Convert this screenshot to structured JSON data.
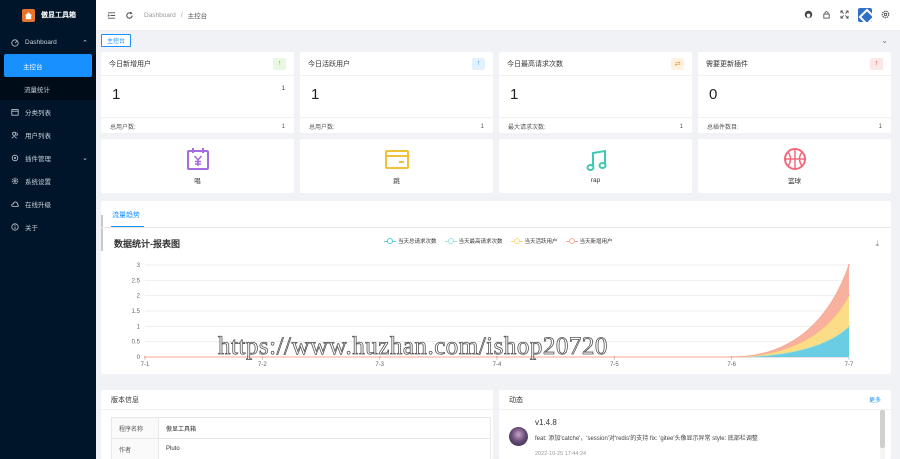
{
  "app": {
    "title": "傲显工具箱"
  },
  "sidebar": {
    "items": [
      {
        "label": "Dashboard",
        "icon": "dashboard-icon"
      },
      {
        "label": "主控台",
        "icon": ""
      },
      {
        "label": "流量统计",
        "icon": ""
      },
      {
        "label": "分类列表",
        "icon": "list-icon"
      },
      {
        "label": "用户列表",
        "icon": "users-icon"
      },
      {
        "label": "插件管理",
        "icon": "plugin-icon"
      },
      {
        "label": "系统设置",
        "icon": "gear-icon"
      },
      {
        "label": "在线升级",
        "icon": "cloud-icon"
      },
      {
        "label": "关于",
        "icon": "info-icon"
      }
    ]
  },
  "header": {
    "breadcrumb_root": "Dashboard",
    "breadcrumb_sep": "/",
    "breadcrumb_current": "主控台"
  },
  "tags": {
    "active": "主控台"
  },
  "stats": [
    {
      "title": "今日新增用户",
      "badge": "↑",
      "badge_color": "#52c41a",
      "badge_bg": "#e8f8e2",
      "value": "1",
      "small": "1",
      "foot_label": "总用户数:",
      "foot_value": "1"
    },
    {
      "title": "今日活跃用户",
      "badge": "↑",
      "badge_color": "#1890ff",
      "badge_bg": "#e3f1ff",
      "value": "1",
      "small": "",
      "foot_label": "总用户数:",
      "foot_value": "1"
    },
    {
      "title": "今日最高请求次数",
      "badge": "⇄",
      "badge_color": "#fa8c16",
      "badge_bg": "#fff1e0",
      "value": "1",
      "small": "",
      "foot_label": "最大请求次数:",
      "foot_value": "1"
    },
    {
      "title": "需要更新插件",
      "badge": "↑",
      "badge_color": "#f5222d",
      "badge_bg": "#fde8e8",
      "value": "0",
      "small": "",
      "foot_label": "总插件数目:",
      "foot_value": "1"
    }
  ],
  "tiles": [
    {
      "label": "唱",
      "icon": "calendar-yen-icon",
      "color": "#a66be0"
    },
    {
      "label": "跳",
      "icon": "wallet-icon",
      "color": "#f0c23a"
    },
    {
      "label": "rap",
      "icon": "music-note-icon",
      "color": "#3ec9b3"
    },
    {
      "label": "篮球",
      "icon": "basketball-icon",
      "color": "#f06a7a"
    }
  ],
  "chart_tab": "流量趋势",
  "chart_data": {
    "type": "area",
    "title": "数据统计-报表图",
    "x": [
      "7-1",
      "7-2",
      "7-3",
      "7-4",
      "7-5",
      "7-6",
      "7-7"
    ],
    "ylim": [
      0,
      3
    ],
    "yticks": [
      "0",
      "0.5",
      "1",
      "1.5",
      "2",
      "2.5",
      "3"
    ],
    "stacked": true,
    "grid": true,
    "legend_position": "top-center",
    "series": [
      {
        "name": "当天总请求次数",
        "color": "#5ac8e0",
        "values": [
          0,
          0,
          0,
          0,
          0,
          0,
          1
        ]
      },
      {
        "name": "当天最高请求次数",
        "color": "#9be3e6",
        "values": [
          0,
          0,
          0,
          0,
          0,
          0,
          0
        ]
      },
      {
        "name": "当天活跃用户",
        "color": "#fbd97a",
        "values": [
          0,
          0,
          0,
          0,
          0,
          0,
          1
        ]
      },
      {
        "name": "当天新增用户",
        "color": "#f8a995",
        "values": [
          0,
          0,
          0,
          0,
          0,
          0,
          1
        ]
      }
    ]
  },
  "watermark": "https://www.huzhan.com/ishop20720",
  "version_card": {
    "title": "版本信息",
    "rows": [
      {
        "k": "程序名称",
        "v": "傲显工具箱"
      },
      {
        "k": "作者",
        "v": "Pluto"
      }
    ]
  },
  "feed_card": {
    "title": "动态",
    "more": "更多",
    "items": [
      {
        "version": "v1.4.8",
        "text": "feat: 添加'catche'，'session'对'redis'的支持 fix: 'gitee'头像显示异常 style: 底部栏调整",
        "time": "2022-10-25 17:44:24"
      }
    ]
  },
  "colors": {
    "accent": "#1890ff",
    "sidebar_bg": "#001529"
  }
}
